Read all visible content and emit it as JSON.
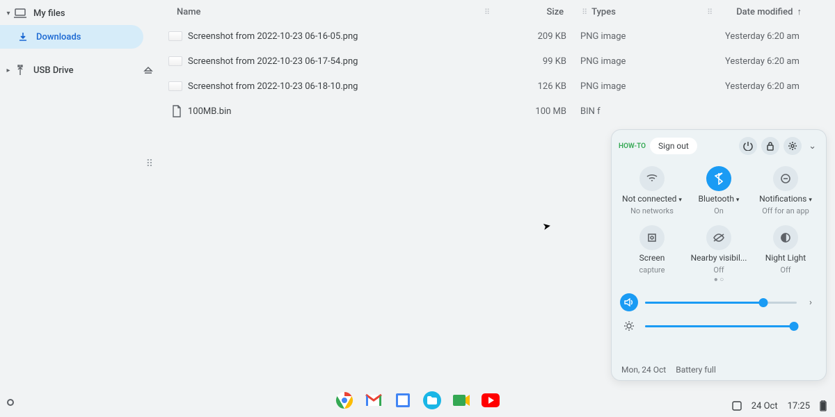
{
  "sidebar": {
    "items": [
      {
        "label": "My files",
        "has_children": true,
        "expanded": true
      },
      {
        "label": "Downloads",
        "active": true
      },
      {
        "label": "USB Drive",
        "has_children": true,
        "expanded": false,
        "eject": true
      }
    ]
  },
  "columns": {
    "name": "Name",
    "size": "Size",
    "types": "Types",
    "date": "Date modified"
  },
  "files": [
    {
      "name": "Screenshot from 2022-10-23 06-16-05.png",
      "size": "209 KB",
      "type": "PNG image",
      "date": "Yesterday 6:20 am",
      "icon": "thumb"
    },
    {
      "name": "Screenshot from 2022-10-23 06-17-54.png",
      "size": "99 KB",
      "type": "PNG image",
      "date": "Yesterday 6:20 am",
      "icon": "thumb"
    },
    {
      "name": "Screenshot from 2022-10-23 06-18-10.png",
      "size": "126 KB",
      "type": "PNG image",
      "date": "Yesterday 6:20 am",
      "icon": "thumb"
    },
    {
      "name": "100MB.bin",
      "size": "100 MB",
      "type": "BIN f",
      "date": "",
      "icon": "file"
    }
  ],
  "quick_settings": {
    "howto": "HOW-TO",
    "signout": "Sign out",
    "tiles": [
      {
        "title": "Not connected",
        "subtitle": "No networks",
        "caret": true
      },
      {
        "title": "Bluetooth",
        "subtitle": "On",
        "caret": true,
        "on": true
      },
      {
        "title": "Notifications",
        "subtitle": "Off for an app",
        "caret": true
      },
      {
        "title": "Screen",
        "subtitle": "capture"
      },
      {
        "title": "Nearby visibil...",
        "subtitle": "Off"
      },
      {
        "title": "Night Light",
        "subtitle": "Off"
      }
    ],
    "volume_pct": 78,
    "brightness_pct": 98,
    "date": "Mon, 24 Oct",
    "battery": "Battery full"
  },
  "shelf": {
    "date": "24 Oct",
    "time": "17:25"
  }
}
